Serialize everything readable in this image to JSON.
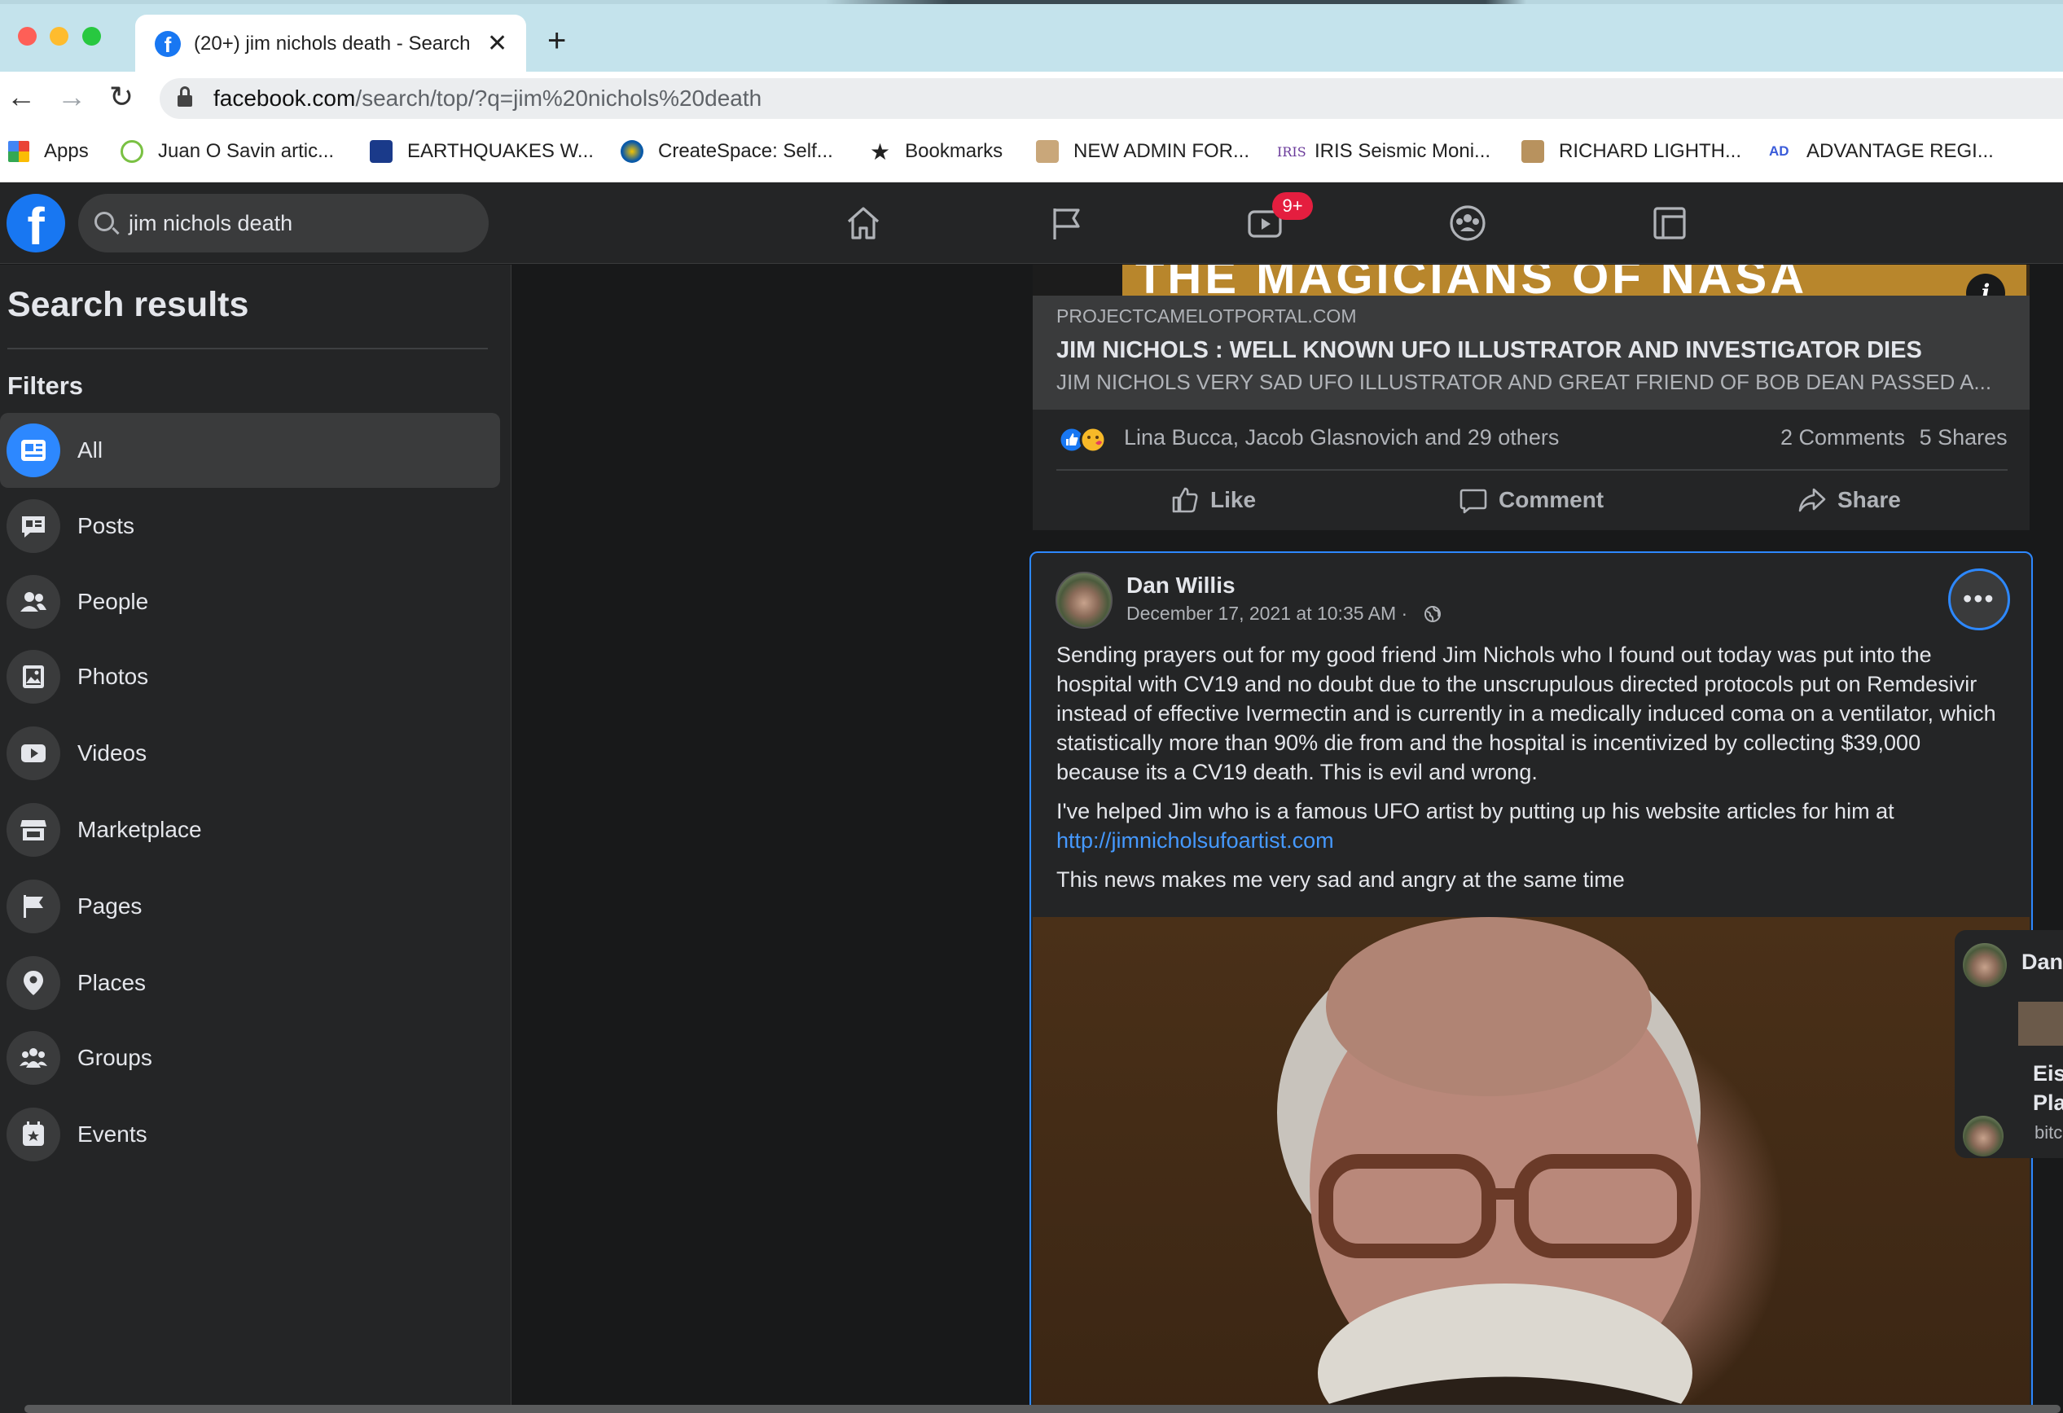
{
  "browser": {
    "tab_title": "(20+) jim nichols death - Search",
    "address_host": "facebook.com",
    "address_path": "/search/top/?q=jim%20nichols%20death",
    "bookmarks": [
      {
        "label": "Apps"
      },
      {
        "label": "Juan O Savin artic..."
      },
      {
        "label": "EARTHQUAKES W..."
      },
      {
        "label": "CreateSpace: Self..."
      },
      {
        "label": "Bookmarks"
      },
      {
        "label": "NEW ADMIN FOR..."
      },
      {
        "label": "IRIS Seismic Moni..."
      },
      {
        "label": "RICHARD LIGHTH..."
      },
      {
        "label": "ADVANTAGE REGI..."
      }
    ]
  },
  "header": {
    "search_query": "jim nichols death",
    "watch_badge": "9+"
  },
  "sidebar": {
    "title": "Search results",
    "filters_heading": "Filters",
    "filters": [
      {
        "label": "All",
        "icon": "news-feed-icon",
        "active": true
      },
      {
        "label": "Posts",
        "icon": "posts-icon"
      },
      {
        "label": "People",
        "icon": "people-icon"
      },
      {
        "label": "Photos",
        "icon": "photos-icon"
      },
      {
        "label": "Videos",
        "icon": "videos-icon"
      },
      {
        "label": "Marketplace",
        "icon": "marketplace-icon"
      },
      {
        "label": "Pages",
        "icon": "pages-flag-icon"
      },
      {
        "label": "Places",
        "icon": "places-pin-icon"
      },
      {
        "label": "Groups",
        "icon": "groups-icon"
      },
      {
        "label": "Events",
        "icon": "events-icon"
      }
    ]
  },
  "post1": {
    "image_banner": "THE MAGICIANS OF NASA",
    "link_domain": "PROJECTCAMELOTPORTAL.COM",
    "link_title": "JIM NICHOLS : WELL KNOWN UFO ILLUSTRATOR AND INVESTIGATOR DIES",
    "link_description": "JIM NICHOLS VERY SAD UFO ILLUSTRATOR AND GREAT FRIEND OF BOB DEAN PASSED A...",
    "reactors": "Lina Bucca, Jacob Glasnovich and 29 others",
    "comments": "2 Comments",
    "shares": "5 Shares",
    "actions": {
      "like": "Like",
      "comment": "Comment",
      "share": "Share"
    }
  },
  "post2": {
    "author": "Dan Willis",
    "timestamp": "December 17, 2021 at 10:35 AM ·",
    "paragraph1": "Sending prayers out for my good friend Jim Nichols who I found out today was put into the hospital with CV19 and no doubt due to the unscrupulous directed protocols put on Remdesivir instead of effective Ivermectin and is currently in a medically induced coma on a ventilator, which statistically more than 90% die from and the hospital is incentivized by collecting $39,000 because its a CV19 death.     This is evil and wrong.",
    "paragraph2": "I've helped Jim who is a famous UFO artist by putting up his website articles for him at",
    "link": "http://jimnicholsufoartist.com",
    "paragraph3": "This news makes me very sad and angry at the same time"
  },
  "chat": {
    "name": "Dan",
    "message": "Eis\nPla",
    "sub": "bitc"
  },
  "colors": {
    "facebook_blue": "#1877f2",
    "accent": "#2d88ff",
    "badge_red": "#e41e3f",
    "link": "#4599ff"
  }
}
